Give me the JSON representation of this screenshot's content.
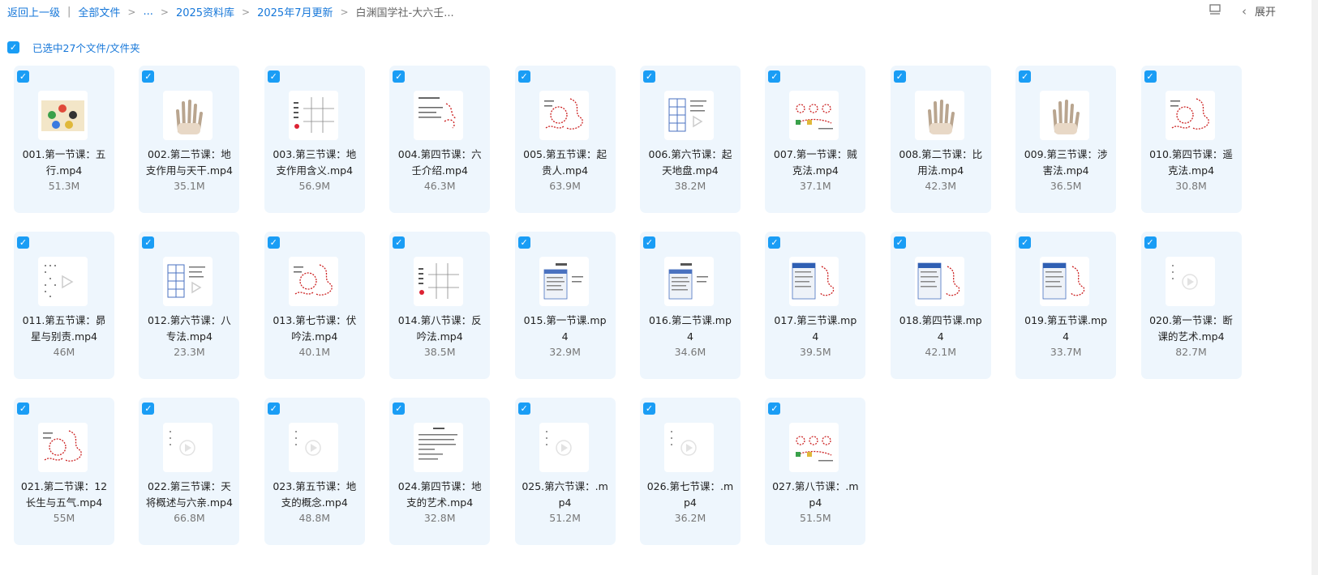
{
  "breadcrumb": {
    "back": "返回上一级",
    "all_files": "全部文件",
    "ellipsis": "...",
    "library": "2025资料库",
    "update": "2025年7月更新",
    "current": "白渊国学社-大六壬..."
  },
  "toolbar": {
    "expand": "展开"
  },
  "selection": {
    "text": "已选中27个文件/文件夹"
  },
  "colors": {
    "accent": "#1677d9",
    "checkbox": "#1a9df5",
    "card_bg": "#eef6fd"
  },
  "files": [
    {
      "name": "001.第一节课：五行.mp4",
      "size": "51.3M",
      "thumb": "wuxing"
    },
    {
      "name": "002.第二节课：地支作用与天干.mp4",
      "size": "35.1M",
      "thumb": "hand"
    },
    {
      "name": "003.第三节课：地支作用含义.mp4",
      "size": "56.9M",
      "thumb": "table"
    },
    {
      "name": "004.第四节课：六壬介绍.mp4",
      "size": "46.3M",
      "thumb": "text-red"
    },
    {
      "name": "005.第五节课：起贵人.mp4",
      "size": "63.9M",
      "thumb": "red-scribble"
    },
    {
      "name": "006.第六节课：起天地盘.mp4",
      "size": "38.2M",
      "thumb": "board"
    },
    {
      "name": "007.第一节课：贼克法.mp4",
      "size": "37.1M",
      "thumb": "diagram"
    },
    {
      "name": "008.第二节课：比用法.mp4",
      "size": "42.3M",
      "thumb": "hand"
    },
    {
      "name": "009.第三节课：涉害法.mp4",
      "size": "36.5M",
      "thumb": "hand"
    },
    {
      "name": "010.第四节课：遥克法.mp4",
      "size": "30.8M",
      "thumb": "red-scribble"
    },
    {
      "name": "011.第五节课：昴星与别责.mp4",
      "size": "46M",
      "thumb": "dots"
    },
    {
      "name": "012.第六节课：八专法.mp4",
      "size": "23.3M",
      "thumb": "board"
    },
    {
      "name": "013.第七节课：伏吟法.mp4",
      "size": "40.1M",
      "thumb": "red-scribble"
    },
    {
      "name": "014.第八节课：反吟法.mp4",
      "size": "38.5M",
      "thumb": "table"
    },
    {
      "name": "015.第一节课.mp4",
      "size": "32.9M",
      "thumb": "screen"
    },
    {
      "name": "016.第二节课.mp4",
      "size": "34.6M",
      "thumb": "screen"
    },
    {
      "name": "017.第三节课.mp4",
      "size": "39.5M",
      "thumb": "screen-red"
    },
    {
      "name": "018.第四节课.mp4",
      "size": "42.1M",
      "thumb": "screen-red"
    },
    {
      "name": "019.第五节课.mp4",
      "size": "33.7M",
      "thumb": "screen-red"
    },
    {
      "name": "020.第一节课：断课的艺术.mp4",
      "size": "82.7M",
      "thumb": "play"
    },
    {
      "name": "021.第二节课：12长生与五气.mp4",
      "size": "55M",
      "thumb": "red-scribble"
    },
    {
      "name": "022.第三节课：天将概述与六亲.mp4",
      "size": "66.8M",
      "thumb": "play"
    },
    {
      "name": "023.第五节课：地支的概念.mp4",
      "size": "48.8M",
      "thumb": "play"
    },
    {
      "name": "024.第四节课：地支的艺术.mp4",
      "size": "32.8M",
      "thumb": "doc"
    },
    {
      "name": "025.第六节课：.mp4",
      "size": "51.2M",
      "thumb": "play"
    },
    {
      "name": "026.第七节课：.mp4",
      "size": "36.2M",
      "thumb": "play"
    },
    {
      "name": "027.第八节课：.mp4",
      "size": "51.5M",
      "thumb": "diagram"
    }
  ]
}
